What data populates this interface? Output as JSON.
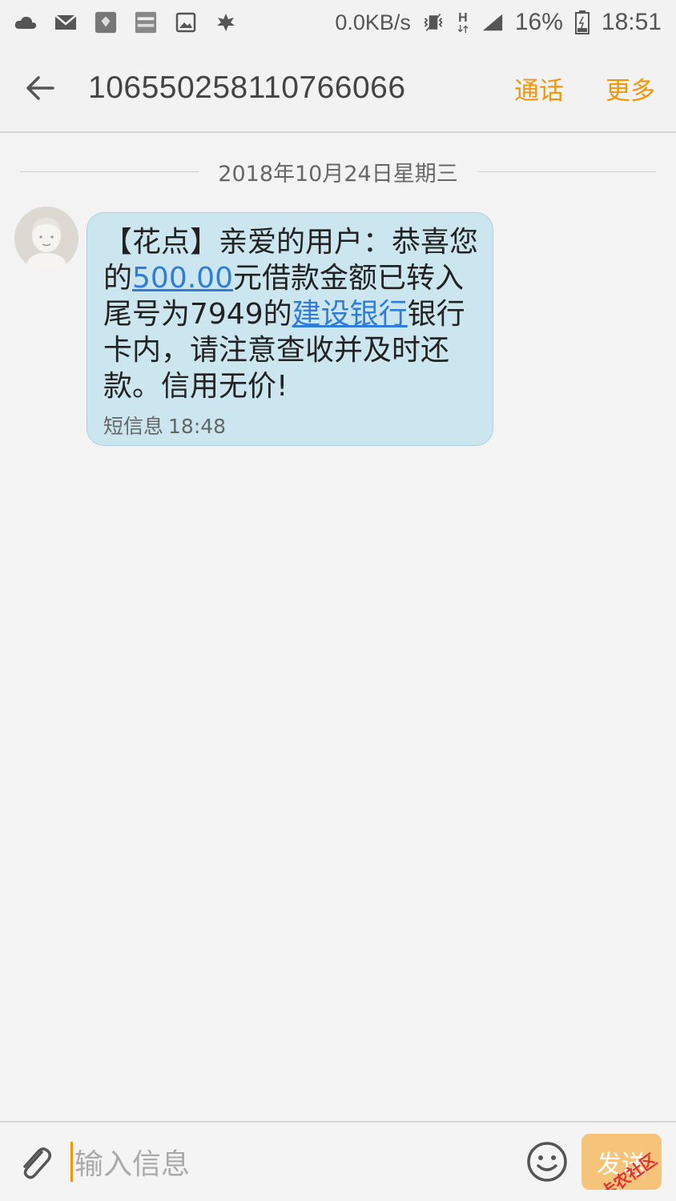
{
  "status_bar": {
    "left_icons": [
      "cloud-icon",
      "mail-icon",
      "app-icon-1",
      "app-icon-2",
      "image-icon",
      "leaf-icon"
    ],
    "network_speed": "0.0KB/s",
    "signal_label": "H",
    "battery_percent": "16%",
    "time": "18:51"
  },
  "header": {
    "title": "1065502581107660​66",
    "call_label": "通话",
    "more_label": "更多"
  },
  "conversation": {
    "date": "2018年10月24日星期三",
    "message": {
      "part1": "【花点】亲爱的用户：恭喜您的",
      "amount_link": "500.00",
      "part2": "元借款金额已转入尾号为7949的",
      "bank_link": "建设银行",
      "part3": "银行卡内，请注意查收并及时还款。信用无价!",
      "source": "短信息",
      "time": "18:48"
    }
  },
  "input_bar": {
    "placeholder": "输入信息",
    "send_label": "发送",
    "watermark": "卡农社区"
  },
  "colors": {
    "accent": "#f0960a",
    "bubble": "#cbe6ee",
    "link": "#2f7dd6"
  }
}
